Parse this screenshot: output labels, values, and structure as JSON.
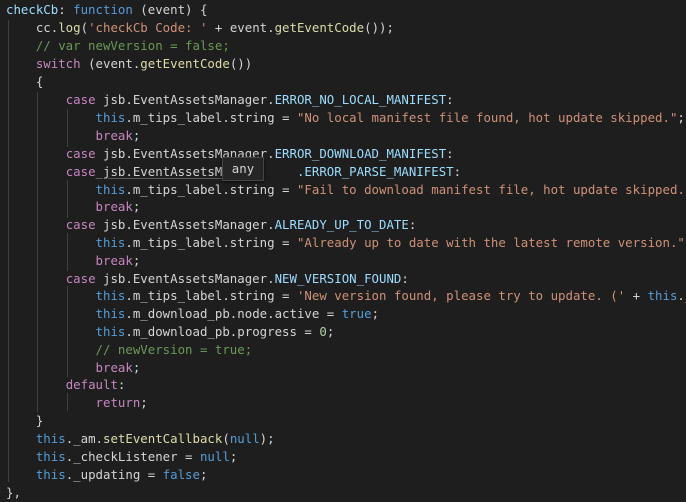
{
  "editor": {
    "lines": [
      [
        {
          "t": "checkCb",
          "c": "t-prop"
        },
        {
          "t": ": ",
          "c": "t-punc"
        },
        {
          "t": "function",
          "c": "t-kw"
        },
        {
          "t": " (event) {",
          "c": "t-punc"
        }
      ],
      [
        {
          "t": "    cc.",
          "c": "t-punc"
        },
        {
          "t": "log",
          "c": "t-fn"
        },
        {
          "t": "(",
          "c": "t-punc"
        },
        {
          "t": "'checkCb Code: '",
          "c": "t-str"
        },
        {
          "t": " + event.",
          "c": "t-punc"
        },
        {
          "t": "getEventCode",
          "c": "t-fn"
        },
        {
          "t": "());",
          "c": "t-punc"
        }
      ],
      [
        {
          "t": "    // var newVersion = false;",
          "c": "t-cmt"
        }
      ],
      [
        {
          "t": "    ",
          "c": "t-punc"
        },
        {
          "t": "switch",
          "c": "t-ctl"
        },
        {
          "t": " (event.",
          "c": "t-punc"
        },
        {
          "t": "getEventCode",
          "c": "t-fn"
        },
        {
          "t": "())",
          "c": "t-punc"
        }
      ],
      [
        {
          "t": "    {",
          "c": "t-punc"
        }
      ],
      [
        {
          "t": "        ",
          "c": "t-punc"
        },
        {
          "t": "case",
          "c": "t-ctl"
        },
        {
          "t": " jsb.EventAssetsManager.",
          "c": "t-punc"
        },
        {
          "t": "ERROR_NO_LOCAL_MANIFEST",
          "c": "t-prop"
        },
        {
          "t": ":",
          "c": "t-punc"
        }
      ],
      [
        {
          "t": "            ",
          "c": "t-punc"
        },
        {
          "t": "this",
          "c": "t-kw"
        },
        {
          "t": ".m_tips_label.string = ",
          "c": "t-punc"
        },
        {
          "t": "\"No local manifest file found, hot update skipped.\"",
          "c": "t-str"
        },
        {
          "t": ";",
          "c": "t-punc"
        }
      ],
      [
        {
          "t": "            ",
          "c": "t-punc"
        },
        {
          "t": "break",
          "c": "t-ctl"
        },
        {
          "t": ";",
          "c": "t-punc"
        }
      ],
      [
        {
          "t": "        ",
          "c": "t-punc"
        },
        {
          "t": "case",
          "c": "t-ctl"
        },
        {
          "t": " jsb.EventAssetsManager.",
          "c": "t-punc"
        },
        {
          "t": "ERROR_DOWNLOAD_MANIFEST",
          "c": "t-prop"
        },
        {
          "t": ":",
          "c": "t-punc"
        }
      ],
      [
        {
          "t": "        ",
          "c": "t-punc"
        },
        {
          "t": "case",
          "c": "t-ctl"
        },
        {
          "t": " jsb.EventAssetsMa",
          "c": "t-punc"
        },
        {
          "t": "         ",
          "c": "t-punc"
        },
        {
          "t": ".ERROR_PARSE_MANIFEST",
          "c": "t-prop"
        },
        {
          "t": ":",
          "c": "t-punc"
        }
      ],
      [
        {
          "t": "            ",
          "c": "t-punc"
        },
        {
          "t": "this",
          "c": "t-kw"
        },
        {
          "t": ".m_tips_label.string = ",
          "c": "t-punc"
        },
        {
          "t": "\"Fail to download manifest file, hot update skipped.\"",
          "c": "t-str"
        },
        {
          "t": ";",
          "c": "t-punc"
        }
      ],
      [
        {
          "t": "            ",
          "c": "t-punc"
        },
        {
          "t": "break",
          "c": "t-ctl"
        },
        {
          "t": ";",
          "c": "t-punc"
        }
      ],
      [
        {
          "t": "        ",
          "c": "t-punc"
        },
        {
          "t": "case",
          "c": "t-ctl"
        },
        {
          "t": " jsb.EventAssetsManager.",
          "c": "t-punc"
        },
        {
          "t": "ALREADY_UP_TO_DATE",
          "c": "t-prop"
        },
        {
          "t": ":",
          "c": "t-punc"
        }
      ],
      [
        {
          "t": "            ",
          "c": "t-punc"
        },
        {
          "t": "this",
          "c": "t-kw"
        },
        {
          "t": ".m_tips_label.string = ",
          "c": "t-punc"
        },
        {
          "t": "\"Already up to date with the latest remote version.\"",
          "c": "t-str"
        },
        {
          "t": ";",
          "c": "t-punc"
        }
      ],
      [
        {
          "t": "            ",
          "c": "t-punc"
        },
        {
          "t": "break",
          "c": "t-ctl"
        },
        {
          "t": ";",
          "c": "t-punc"
        }
      ],
      [
        {
          "t": "        ",
          "c": "t-punc"
        },
        {
          "t": "case",
          "c": "t-ctl"
        },
        {
          "t": " jsb.EventAssetsManager.",
          "c": "t-punc"
        },
        {
          "t": "NEW_VERSION_FOUND",
          "c": "t-prop"
        },
        {
          "t": ":",
          "c": "t-punc"
        }
      ],
      [
        {
          "t": "            ",
          "c": "t-punc"
        },
        {
          "t": "this",
          "c": "t-kw"
        },
        {
          "t": ".m_tips_label.string = ",
          "c": "t-punc"
        },
        {
          "t": "'New version found, please try to update. ('",
          "c": "t-str"
        },
        {
          "t": " + ",
          "c": "t-punc"
        },
        {
          "t": "this",
          "c": "t-kw"
        },
        {
          "t": "._am.",
          "c": "t-punc"
        }
      ],
      [
        {
          "t": "            ",
          "c": "t-punc"
        },
        {
          "t": "this",
          "c": "t-kw"
        },
        {
          "t": ".m_download_pb.node.active = ",
          "c": "t-punc"
        },
        {
          "t": "true",
          "c": "t-kw"
        },
        {
          "t": ";",
          "c": "t-punc"
        }
      ],
      [
        {
          "t": "            ",
          "c": "t-punc"
        },
        {
          "t": "this",
          "c": "t-kw"
        },
        {
          "t": ".m_download_pb.progress = ",
          "c": "t-punc"
        },
        {
          "t": "0",
          "c": "t-num"
        },
        {
          "t": ";",
          "c": "t-punc"
        }
      ],
      [
        {
          "t": "            // newVersion = true;",
          "c": "t-cmt"
        }
      ],
      [
        {
          "t": "            ",
          "c": "t-punc"
        },
        {
          "t": "break",
          "c": "t-ctl"
        },
        {
          "t": ";",
          "c": "t-punc"
        }
      ],
      [
        {
          "t": "        ",
          "c": "t-punc"
        },
        {
          "t": "default",
          "c": "t-ctl"
        },
        {
          "t": ":",
          "c": "t-punc"
        }
      ],
      [
        {
          "t": "            ",
          "c": "t-punc"
        },
        {
          "t": "return",
          "c": "t-ctl"
        },
        {
          "t": ";",
          "c": "t-punc"
        }
      ],
      [
        {
          "t": "    }",
          "c": "t-punc"
        }
      ],
      [
        {
          "t": "    ",
          "c": "t-punc"
        },
        {
          "t": "this",
          "c": "t-kw"
        },
        {
          "t": "._am.",
          "c": "t-punc"
        },
        {
          "t": "setEventCallback",
          "c": "t-fn"
        },
        {
          "t": "(",
          "c": "t-punc"
        },
        {
          "t": "null",
          "c": "t-kw"
        },
        {
          "t": ");",
          "c": "t-punc"
        }
      ],
      [
        {
          "t": "    ",
          "c": "t-punc"
        },
        {
          "t": "this",
          "c": "t-kw"
        },
        {
          "t": "._checkListener = ",
          "c": "t-punc"
        },
        {
          "t": "null",
          "c": "t-kw"
        },
        {
          "t": ";",
          "c": "t-punc"
        }
      ],
      [
        {
          "t": "    ",
          "c": "t-punc"
        },
        {
          "t": "this",
          "c": "t-kw"
        },
        {
          "t": "._updating = ",
          "c": "t-punc"
        },
        {
          "t": "false",
          "c": "t-kw"
        },
        {
          "t": ";",
          "c": "t-punc"
        }
      ],
      [
        {
          "t": "},",
          "c": "t-punc"
        }
      ]
    ]
  },
  "hover_tooltip": {
    "text": "any"
  },
  "colors": {
    "background": "#1e1e1e",
    "keyword": "#569cd6",
    "control": "#c586c0",
    "function": "#dcdcaa",
    "string": "#ce9178",
    "comment": "#6a9955",
    "property": "#9cdcfe"
  }
}
